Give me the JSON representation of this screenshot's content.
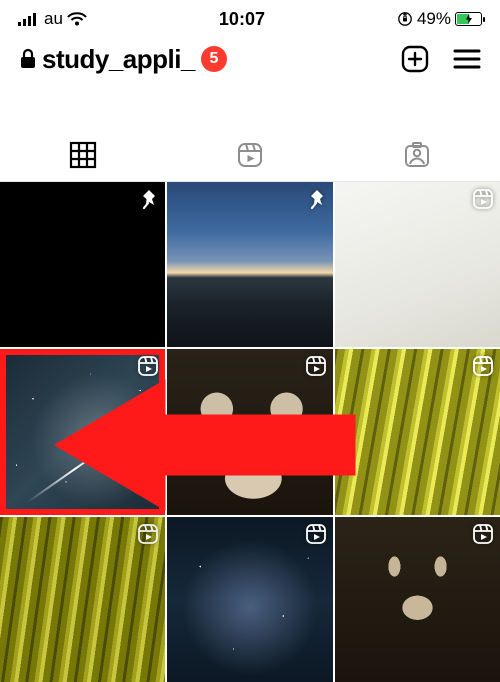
{
  "status": {
    "carrier": "au",
    "time": "10:07",
    "battery_pct": "49%"
  },
  "header": {
    "username": "study_appli_",
    "notification_count": "5"
  },
  "tabs": [
    {
      "name": "posts-grid",
      "active": true
    },
    {
      "name": "reels",
      "active": false
    },
    {
      "name": "tagged",
      "active": false
    }
  ],
  "grid": [
    {
      "thumb": "t-black",
      "badge": "pin",
      "highlight": false
    },
    {
      "thumb": "t-sunset",
      "badge": "pin",
      "highlight": false
    },
    {
      "thumb": "t-white",
      "badge": "reel",
      "highlight": false
    },
    {
      "thumb": "t-stars",
      "badge": "reel",
      "highlight": true
    },
    {
      "thumb": "t-cat",
      "badge": "reel",
      "highlight": false
    },
    {
      "thumb": "t-bamboo",
      "badge": "reel",
      "highlight": false
    },
    {
      "thumb": "t-bamboo2",
      "badge": "reel",
      "highlight": false
    },
    {
      "thumb": "t-galaxy",
      "badge": "reel",
      "highlight": false
    },
    {
      "thumb": "t-catface",
      "badge": "reel",
      "highlight": false
    }
  ],
  "colors": {
    "badge_red": "#ff3b30",
    "arrow_red": "#ff1a1a",
    "battery_green": "#34c759"
  }
}
